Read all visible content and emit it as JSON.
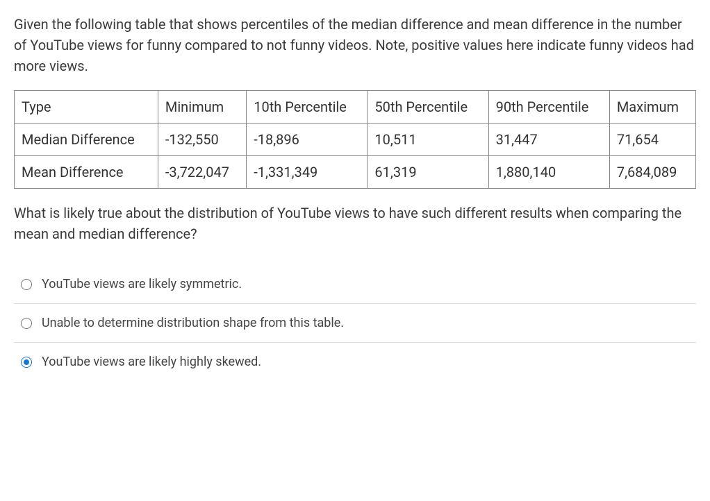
{
  "question": {
    "intro": "Given the following table that shows percentiles of the median difference and mean difference in the number of YouTube views for funny compared to not funny videos. Note, positive values here indicate funny videos had more views.",
    "followup": "What is likely true about the distribution of YouTube views to have such different results when comparing the mean and median difference?"
  },
  "table": {
    "headers": {
      "c0": "Type",
      "c1": "Minimum",
      "c2": "10th Percentile",
      "c3": "50th Percentile",
      "c4": "90th Percentile",
      "c5": "Maximum"
    },
    "rows": [
      {
        "c0": "Median Difference",
        "c1": "-132,550",
        "c2": "-18,896",
        "c3": "10,511",
        "c4": "31,447",
        "c5": "71,654"
      },
      {
        "c0": "Mean Difference",
        "c1": "-3,722,047",
        "c2": "-1,331,349",
        "c3": "61,319",
        "c4": "1,880,140",
        "c5": "7,684,089"
      }
    ]
  },
  "options": [
    {
      "label": "YouTube views are likely symmetric.",
      "selected": false
    },
    {
      "label": "Unable to determine distribution shape from this table.",
      "selected": false
    },
    {
      "label": "YouTube views are likely highly skewed.",
      "selected": true
    }
  ],
  "chart_data": {
    "type": "table",
    "columns": [
      "Type",
      "Minimum",
      "10th Percentile",
      "50th Percentile",
      "90th Percentile",
      "Maximum"
    ],
    "rows": [
      [
        "Median Difference",
        -132550,
        -18896,
        10511,
        31447,
        71654
      ],
      [
        "Mean Difference",
        -3722047,
        -1331349,
        61319,
        1880140,
        7684089
      ]
    ]
  }
}
